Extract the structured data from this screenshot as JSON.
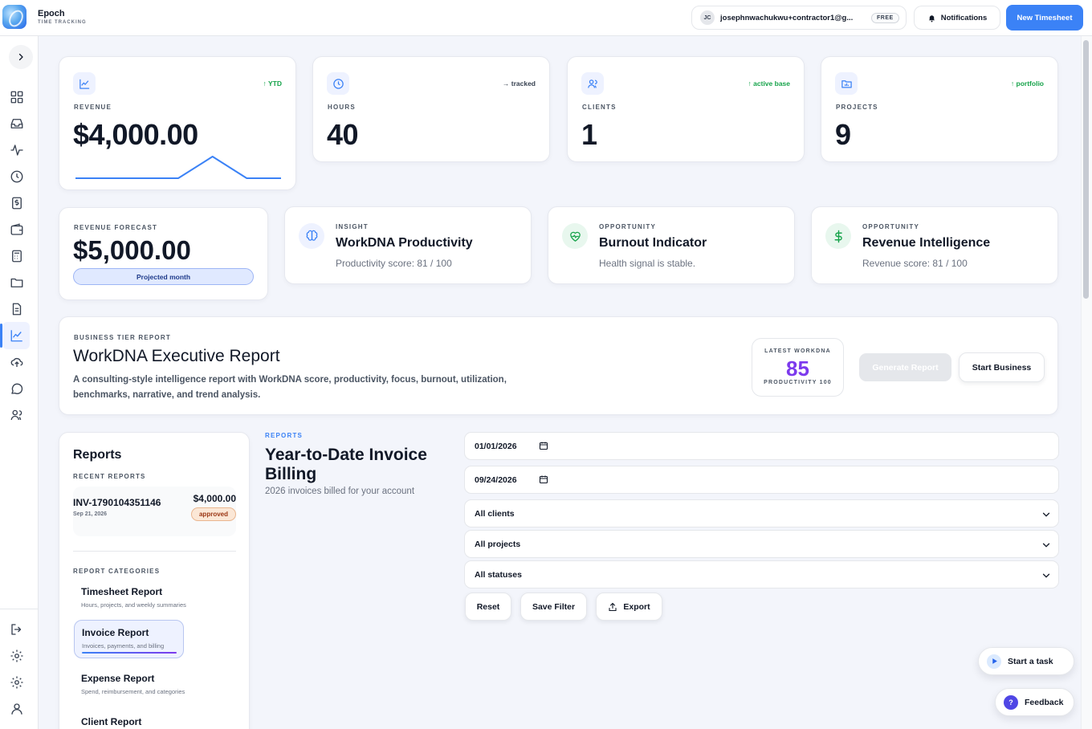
{
  "brand": {
    "name": "Epoch",
    "tagline": "TIME TRACKING"
  },
  "header": {
    "avatar_initials": "JC",
    "user_email": "josephnwachukwu+contractor1@g...",
    "plan": "FREE",
    "notifications_label": "Notifications",
    "new_timesheet_label": "New Timesheet"
  },
  "sidebar": {
    "items": [
      {
        "name": "dashboard-icon"
      },
      {
        "name": "inbox-icon"
      },
      {
        "name": "activity-icon"
      },
      {
        "name": "clock-icon"
      },
      {
        "name": "invoice-icon"
      },
      {
        "name": "wallet-icon"
      },
      {
        "name": "calculator-icon"
      },
      {
        "name": "folder-icon"
      },
      {
        "name": "document-icon"
      },
      {
        "name": "reports-chart-icon",
        "active": true
      },
      {
        "name": "upload-cloud-icon"
      },
      {
        "name": "chat-icon"
      },
      {
        "name": "users-icon"
      }
    ],
    "bottom_items": [
      {
        "name": "logout-icon"
      },
      {
        "name": "settings-icon"
      },
      {
        "name": "settings-icon"
      },
      {
        "name": "profile-icon"
      }
    ]
  },
  "stats": [
    {
      "label": "REVENUE",
      "value": "$4,000.00",
      "trend": "↑ YTD",
      "icon": "line-chart-icon",
      "sparkline": [
        0,
        0,
        0,
        0,
        1,
        0,
        0
      ]
    },
    {
      "label": "HOURS",
      "value": "40",
      "trend": "→ tracked",
      "icon": "clock-icon"
    },
    {
      "label": "CLIENTS",
      "value": "1",
      "trend": "↑ active base",
      "icon": "users-icon"
    },
    {
      "label": "PROJECTS",
      "value": "9",
      "trend": "↑ portfolio",
      "icon": "folder-chart-icon"
    }
  ],
  "forecast": {
    "label": "REVENUE FORECAST",
    "value": "$5,000.00",
    "pill": "Projected month"
  },
  "insights": [
    {
      "eyebrow": "INSIGHT",
      "title": "WorkDNA Productivity",
      "subtitle": "Productivity score: 81 / 100",
      "icon": "brain-icon"
    },
    {
      "eyebrow": "OPPORTUNITY",
      "title": "Burnout Indicator",
      "subtitle": "Health signal is stable.",
      "icon": "heart-pulse-icon"
    },
    {
      "eyebrow": "OPPORTUNITY",
      "title": "Revenue Intelligence",
      "subtitle": "Revenue score: 81 / 100",
      "icon": "dollar-icon"
    }
  ],
  "executive": {
    "eyebrow": "BUSINESS TIER REPORT",
    "title": "WorkDNA Executive Report",
    "description": "A consulting-style intelligence report with WorkDNA score, productivity, focus, burnout, utilization, benchmarks, narrative, and trend analysis.",
    "score_label": "LATEST WORKDNA",
    "score": "85",
    "score_sub": "PRODUCTIVITY 100",
    "generate_label": "Generate Report",
    "start_business_label": "Start Business"
  },
  "reports_panel": {
    "title": "Reports",
    "recent_label": "RECENT REPORTS",
    "recent": [
      {
        "number": "INV-1790104351146",
        "date": "Sep 21, 2026",
        "amount": "$4,000.00",
        "status": "approved"
      }
    ],
    "categories_label": "REPORT CATEGORIES",
    "categories": [
      {
        "name": "Timesheet Report",
        "desc": "Hours, projects, and weekly summaries"
      },
      {
        "name": "Invoice Report",
        "desc": "Invoices, payments, and billing",
        "active": true
      },
      {
        "name": "Expense Report",
        "desc": "Spend, reimbursement, and categories"
      },
      {
        "name": "Client Report",
        "desc": ""
      }
    ]
  },
  "report": {
    "eyebrow": "REPORTS",
    "title": "Year-to-Date Invoice Billing",
    "subtitle": "2026 invoices billed for your account",
    "start_date": "01/01/2026",
    "end_date": "09/24/2026",
    "client_select": "All clients",
    "project_select": "All projects",
    "status_select": "All statuses",
    "reset_label": "Reset",
    "save_filter_label": "Save Filter",
    "export_label": "Export"
  },
  "floating": {
    "start_task_label": "Start a task",
    "feedback_label": "Feedback",
    "feedback_glyph": "?"
  },
  "colors": {
    "accent": "#3b82f6",
    "purple": "#7c3aed",
    "green": "#16a34a"
  }
}
